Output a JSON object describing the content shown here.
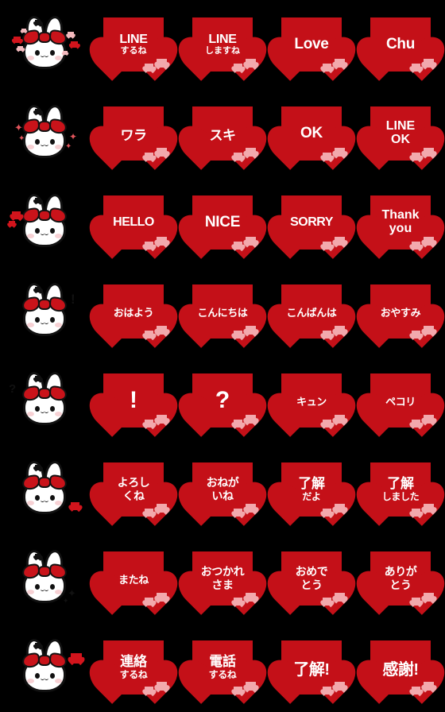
{
  "meta": {
    "background_color": "#000000",
    "heart_color": "#c41018",
    "mini_heart_color": "#f2a9ad",
    "text_color": "#ffffff",
    "bow_color": "#c9131a",
    "outline_color": "#111111",
    "columns": 5,
    "rows": 8
  },
  "grid": [
    {
      "row": 1,
      "character": {
        "name": "bunny-hearts-floating",
        "decorations": [
          "heart",
          "heart",
          "heart",
          "heart",
          "heart",
          "heart"
        ]
      },
      "stickers": [
        {
          "name": "line-suruyone",
          "line1": "LINE",
          "line2": "するね",
          "style": "t-enjp"
        },
        {
          "name": "line-shimasune",
          "line1": "LINE",
          "line2": "しますね",
          "style": "t-enjp"
        },
        {
          "name": "love",
          "line1": "Love",
          "line2": "",
          "style": "t-en1"
        },
        {
          "name": "chu",
          "line1": "Chu",
          "line2": "",
          "style": "t-en1"
        }
      ]
    },
    {
      "row": 2,
      "character": {
        "name": "bunny-sparkles",
        "decorations": [
          "sparkle",
          "sparkle",
          "sparkle",
          "sparkle"
        ]
      },
      "stickers": [
        {
          "name": "wara",
          "line1": "ワラ",
          "line2": "",
          "style": "t-jp1"
        },
        {
          "name": "suki",
          "line1": "スキ",
          "line2": "",
          "style": "t-jp1"
        },
        {
          "name": "ok",
          "line1": "OK",
          "line2": "",
          "style": "t-en1"
        },
        {
          "name": "line-ok",
          "line1": "LINE",
          "line2": "OK",
          "style": "t-en2"
        }
      ]
    },
    {
      "row": 3,
      "character": {
        "name": "bunny-two-hearts",
        "decorations": [
          "heart",
          "heart"
        ]
      },
      "stickers": [
        {
          "name": "hello",
          "line1": "HELLO",
          "line2": "",
          "style": "t-en-sm"
        },
        {
          "name": "nice",
          "line1": "NICE",
          "line2": "",
          "style": "t-en1"
        },
        {
          "name": "sorry",
          "line1": "SORRY",
          "line2": "",
          "style": "t-en-sm"
        },
        {
          "name": "thank-you",
          "line1": "Thank",
          "line2": "you",
          "style": "t-en2"
        }
      ]
    },
    {
      "row": 4,
      "character": {
        "name": "bunny-exclamation",
        "decorations": [
          "exclamation"
        ]
      },
      "stickers": [
        {
          "name": "ohayou",
          "line1": "おはよう",
          "line2": "",
          "style": "t-jp-sm"
        },
        {
          "name": "konnichiwa",
          "line1": "こんにちは",
          "line2": "",
          "style": "t-jp-sm"
        },
        {
          "name": "konbanwa",
          "line1": "こんばんは",
          "line2": "",
          "style": "t-jp-sm"
        },
        {
          "name": "oyasumi",
          "line1": "おやすみ",
          "line2": "",
          "style": "t-jp-sm"
        }
      ]
    },
    {
      "row": 5,
      "character": {
        "name": "bunny-question",
        "decorations": [
          "question"
        ]
      },
      "stickers": [
        {
          "name": "exclamation-mark",
          "line1": "!",
          "line2": "",
          "style": "t-punct"
        },
        {
          "name": "question-mark",
          "line1": "?",
          "line2": "",
          "style": "t-punct"
        },
        {
          "name": "kyun",
          "line1": "キュン",
          "line2": "",
          "style": "t-jp-sm"
        },
        {
          "name": "pekori",
          "line1": "ペコリ",
          "line2": "",
          "style": "t-jp-sm"
        }
      ]
    },
    {
      "row": 6,
      "character": {
        "name": "bunny-single-heart-right",
        "decorations": [
          "heart"
        ]
      },
      "stickers": [
        {
          "name": "yoroshikune",
          "line1": "よろし",
          "line2": "くね",
          "style": "t-jp2"
        },
        {
          "name": "onegai-ine",
          "line1": "おねが",
          "line2": "いね",
          "style": "t-jp2"
        },
        {
          "name": "ryoukai-dayo",
          "line1": "了解",
          "line2": "だよ",
          "style": "t-kanji"
        },
        {
          "name": "ryoukai-shimashita",
          "line1": "了解",
          "line2": "しました",
          "style": "t-kanji"
        }
      ]
    },
    {
      "row": 7,
      "character": {
        "name": "bunny-dark-sparkles",
        "decorations": [
          "dark-sparkle",
          "dark-sparkle"
        ]
      },
      "stickers": [
        {
          "name": "matane",
          "line1": "またね",
          "line2": "",
          "style": "t-jp-sm"
        },
        {
          "name": "otsukaresama",
          "line1": "おつかれ",
          "line2": "さま",
          "style": "t-jp2"
        },
        {
          "name": "omedetou",
          "line1": "おめで",
          "line2": "とう",
          "style": "t-jp2"
        },
        {
          "name": "arigatou",
          "line1": "ありが",
          "line2": "とう",
          "style": "t-jp2"
        }
      ]
    },
    {
      "row": 8,
      "character": {
        "name": "bunny-heart-upper-right",
        "decorations": [
          "heart"
        ]
      },
      "stickers": [
        {
          "name": "renraku-suruyone",
          "line1": "連絡",
          "line2": "するね",
          "style": "t-kanji"
        },
        {
          "name": "denwa-suruyone",
          "line1": "電話",
          "line2": "するね",
          "style": "t-kanji"
        },
        {
          "name": "ryoukai",
          "line1": "了解!",
          "line2": "",
          "style": "t-kanji-big"
        },
        {
          "name": "kansha",
          "line1": "感謝!",
          "line2": "",
          "style": "t-kanji-big"
        }
      ]
    }
  ]
}
